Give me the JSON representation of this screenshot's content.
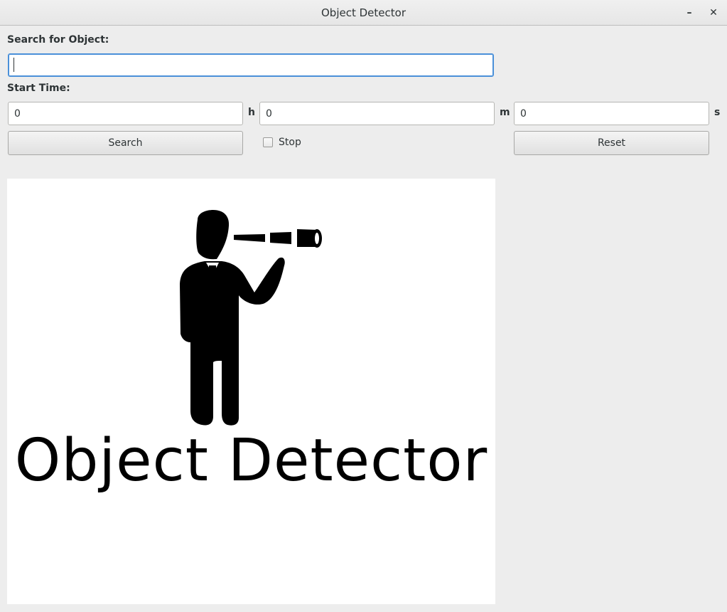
{
  "window": {
    "title": "Object Detector",
    "minimize_glyph": "–",
    "close_glyph": "✕"
  },
  "search": {
    "label": "Search for Object:",
    "value": "",
    "placeholder": ""
  },
  "start_time": {
    "label": "Start Time:",
    "hours": {
      "value": "0",
      "unit": "h"
    },
    "minutes": {
      "value": "0",
      "unit": "m"
    },
    "seconds": {
      "value": "0",
      "unit": "s"
    }
  },
  "controls": {
    "search_label": "Search",
    "stop_label": "Stop",
    "stop_checked": false,
    "reset_label": "Reset"
  },
  "logo": {
    "icon": "person-with-telescope-icon",
    "text": "Object Detector",
    "color": "#000000",
    "background": "#ffffff"
  },
  "theme": {
    "focus_color": "#4a90d9",
    "window_bg": "#ededed"
  }
}
